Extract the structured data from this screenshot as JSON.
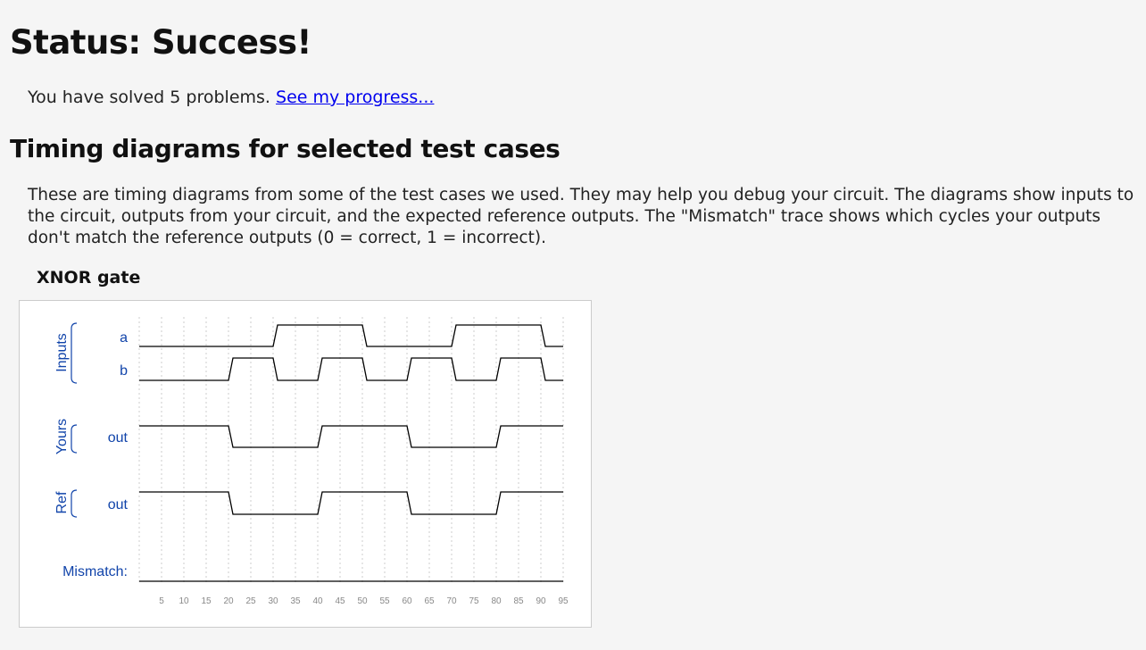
{
  "status": {
    "title": "Status: Success!"
  },
  "progress": {
    "text": "You have solved 5 problems. ",
    "link_label": "See my progress..."
  },
  "section": {
    "title": "Timing diagrams for selected test cases"
  },
  "description": "These are timing diagrams from some of the test cases we used. They may help you debug your circuit. The diagrams show inputs to the circuit, outputs from your circuit, and the expected reference outputs. The \"Mismatch\" trace shows which cycles your outputs don't match the reference outputs (0 = correct, 1 = incorrect).",
  "diagram": {
    "title": "XNOR gate",
    "groups": {
      "inputs": "Inputs",
      "yours": "Yours",
      "ref": "Ref"
    },
    "signals": {
      "a": "a",
      "b": "b",
      "yours_out": "out",
      "ref_out": "out",
      "mismatch": "Mismatch:"
    },
    "time_ticks": [
      "5",
      "10",
      "15",
      "20",
      "25",
      "30",
      "35",
      "40",
      "45",
      "50",
      "55",
      "60",
      "65",
      "70",
      "75",
      "80",
      "85",
      "90",
      "95"
    ],
    "colors": {
      "label": "#1144aa",
      "trace": "#000000",
      "grid": "#cccccc"
    },
    "waveforms": {
      "a": [
        [
          0,
          0
        ],
        [
          30,
          1
        ],
        [
          50,
          0
        ],
        [
          70,
          1
        ],
        [
          90,
          0
        ]
      ],
      "b": [
        [
          0,
          0
        ],
        [
          20,
          1
        ],
        [
          30,
          0
        ],
        [
          40,
          1
        ],
        [
          50,
          0
        ],
        [
          60,
          1
        ],
        [
          70,
          0
        ],
        [
          80,
          1
        ],
        [
          90,
          0
        ]
      ],
      "yours_out": [
        [
          0,
          1
        ],
        [
          20,
          0
        ],
        [
          40,
          1
        ],
        [
          60,
          0
        ],
        [
          80,
          1
        ]
      ],
      "ref_out": [
        [
          0,
          1
        ],
        [
          20,
          0
        ],
        [
          40,
          1
        ],
        [
          60,
          0
        ],
        [
          80,
          1
        ]
      ],
      "mismatch": [
        [
          0,
          0
        ]
      ]
    },
    "time_range": [
      0,
      95
    ]
  }
}
